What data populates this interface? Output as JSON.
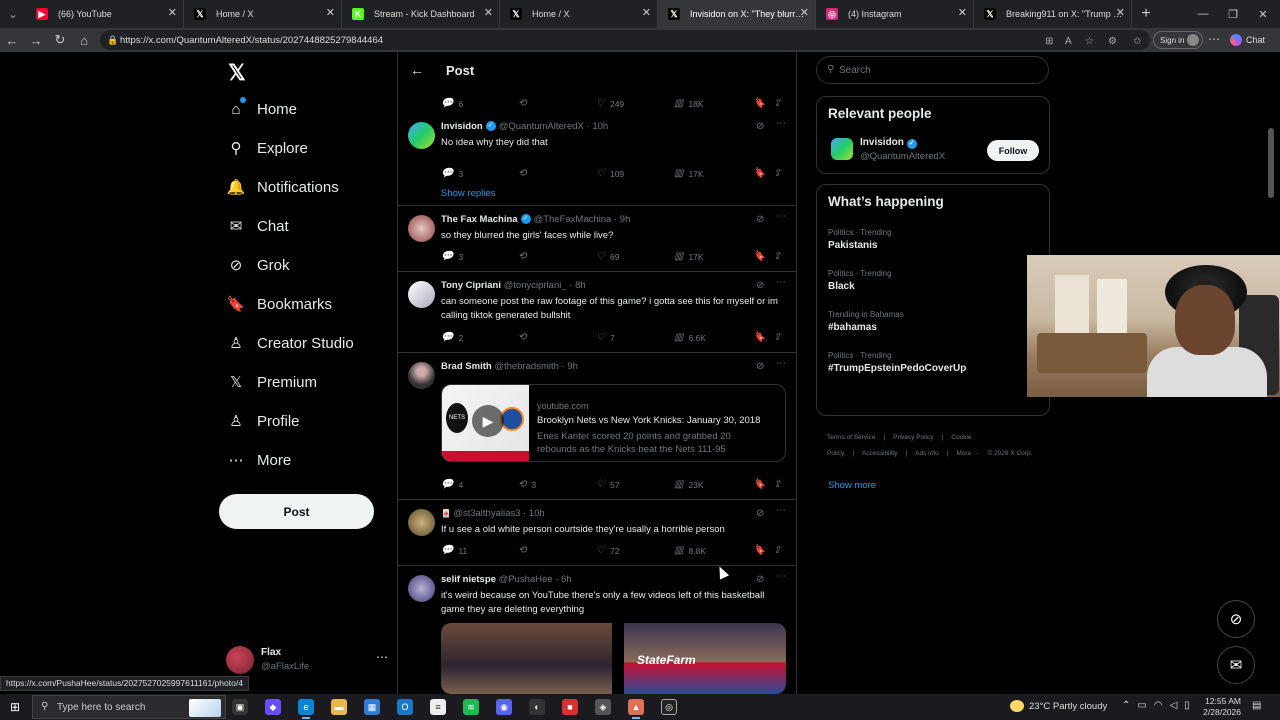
{
  "browser": {
    "tabs": [
      {
        "title": "(66) YouTube",
        "icon": "youtube-icon",
        "color": "#ff0033",
        "glyph": "▶"
      },
      {
        "title": "Home / X",
        "icon": "x-icon",
        "color": "#000000",
        "glyph": "𝕏"
      },
      {
        "title": "Stream - Kick Dashboard",
        "icon": "kick-icon",
        "color": "#53fc18",
        "glyph": "K"
      },
      {
        "title": "Home / X",
        "icon": "x-icon",
        "color": "#000000",
        "glyph": "𝕏"
      },
      {
        "title": "Invisidon on X: \"They blurred out",
        "icon": "x-icon",
        "color": "#000000",
        "glyph": "𝕏"
      },
      {
        "title": "(4) Instagram",
        "icon": "instagram-icon",
        "color": "#d62976",
        "glyph": "◎"
      },
      {
        "title": "Breaking911 on X: \"Trump on his",
        "icon": "x-icon",
        "color": "#000000",
        "glyph": "𝕏"
      }
    ],
    "url": "https://x.com/QuantumAlteredX/status/2027448825279844464",
    "signin_label": "Sign in",
    "chat_label": "Chat",
    "status_url": "https://x.com/PushaHee/status/2027527025997611161/photo/4"
  },
  "nav": {
    "items": [
      {
        "label": "Home",
        "icon": "home-icon",
        "glyph": "⌂"
      },
      {
        "label": "Explore",
        "icon": "search-icon",
        "glyph": "⚲"
      },
      {
        "label": "Notifications",
        "icon": "bell-icon",
        "glyph": "🔔"
      },
      {
        "label": "Chat",
        "icon": "mail-icon",
        "glyph": "✉"
      },
      {
        "label": "Grok",
        "icon": "grok-icon",
        "glyph": "⊘"
      },
      {
        "label": "Bookmarks",
        "icon": "bookmark-icon",
        "glyph": "🔖"
      },
      {
        "label": "Creator Studio",
        "icon": "creator-studio-icon",
        "glyph": "♙"
      },
      {
        "label": "Premium",
        "icon": "x-premium-icon",
        "glyph": "𝕏"
      },
      {
        "label": "Profile",
        "icon": "profile-icon",
        "glyph": "♙"
      },
      {
        "label": "More",
        "icon": "more-circle-icon",
        "glyph": "⋯"
      }
    ],
    "post_label": "Post",
    "account": {
      "name": "Flax",
      "handle": "@aFlaxLife"
    }
  },
  "main": {
    "header_title": "Post",
    "top_actions": {
      "replies": "6",
      "reposts": "",
      "likes": "249",
      "views": "18K"
    },
    "tweets": [
      {
        "name": "Invisidon",
        "verified": true,
        "handle": "@QuantumAlteredX",
        "time": "10h",
        "text": "No idea why they did that",
        "replies": "3",
        "reposts": "",
        "likes": "109",
        "views": "17K"
      },
      {
        "name": "The Fax Machina",
        "verified": true,
        "handle": "@TheFaxMachina",
        "time": "9h",
        "text": "so they blurred the girls' faces while live?",
        "replies": "3",
        "reposts": "",
        "likes": "69",
        "views": "17K"
      },
      {
        "name": "Tony Cipriani",
        "verified": false,
        "handle": "@tonycipriani_",
        "time": "8h",
        "text": "can someone post the raw footage of this game? i gotta see this for myself or im calling tiktok generated bullshit",
        "replies": "2",
        "reposts": "",
        "likes": "7",
        "views": "6.6K"
      },
      {
        "name": "Brad Smith",
        "verified": false,
        "handle": "@thebradsmith",
        "time": "9h",
        "text": "",
        "replies": "4",
        "reposts": "3",
        "likes": "57",
        "views": "23K"
      },
      {
        "name": "",
        "verified": false,
        "handle": "@st3althyalias3",
        "time": "10h",
        "text": "If u see a old white person courtside they're usally a horrible person",
        "replies": "11",
        "reposts": "",
        "likes": "72",
        "views": "8.8K"
      },
      {
        "name": "selif nietspe",
        "verified": false,
        "handle": "@PushaHee",
        "time": "6h",
        "text": "it's weird because on YouTube there's only a few videos left of this basketball game they are deleting everything",
        "replies": "",
        "reposts": "",
        "likes": "",
        "views": ""
      }
    ],
    "show_replies": "Show replies",
    "card": {
      "domain": "youtube.com",
      "title": "Brooklyn Nets vs New York Knicks: January 30, 2018",
      "description": "Enes Kanter scored 20 points and grabbed 20 rebounds as the Knicks beat the Nets 111-95",
      "thumb_text": "NETS"
    },
    "media_text": "StateFarm"
  },
  "right": {
    "search_placeholder": "Search",
    "relevant_title": "Relevant people",
    "relevant": {
      "name": "Invisidon",
      "handle": "@QuantumAlteredX",
      "follow_label": "Follow"
    },
    "happening_title": "What’s happening",
    "trends": [
      {
        "category": "Politics · Trending",
        "name": "Pakistanis"
      },
      {
        "category": "Politics · Trending",
        "name": "Black"
      },
      {
        "category": "Trending in Bahamas",
        "name": "#bahamas"
      },
      {
        "category": "Politics · Trending",
        "name": "#TrumpEpsteinPedoCoverUp"
      }
    ],
    "show_more": "Show more",
    "footer": [
      "Terms of Service",
      "|",
      "Privacy Policy",
      "|",
      "Cookie Policy",
      "|",
      "Accessibility",
      "|",
      "Ads info",
      "|",
      "More ···",
      "© 2026 X Corp."
    ]
  },
  "taskbar": {
    "search_placeholder": "Type here to search",
    "weather": "23°C  Partly cloudy",
    "time": "12:55 AM",
    "date": "2/28/2026"
  },
  "colors": {
    "accent": "#1d9bf0",
    "bg": "#000000",
    "border": "#2f3336",
    "muted": "#71767b"
  }
}
